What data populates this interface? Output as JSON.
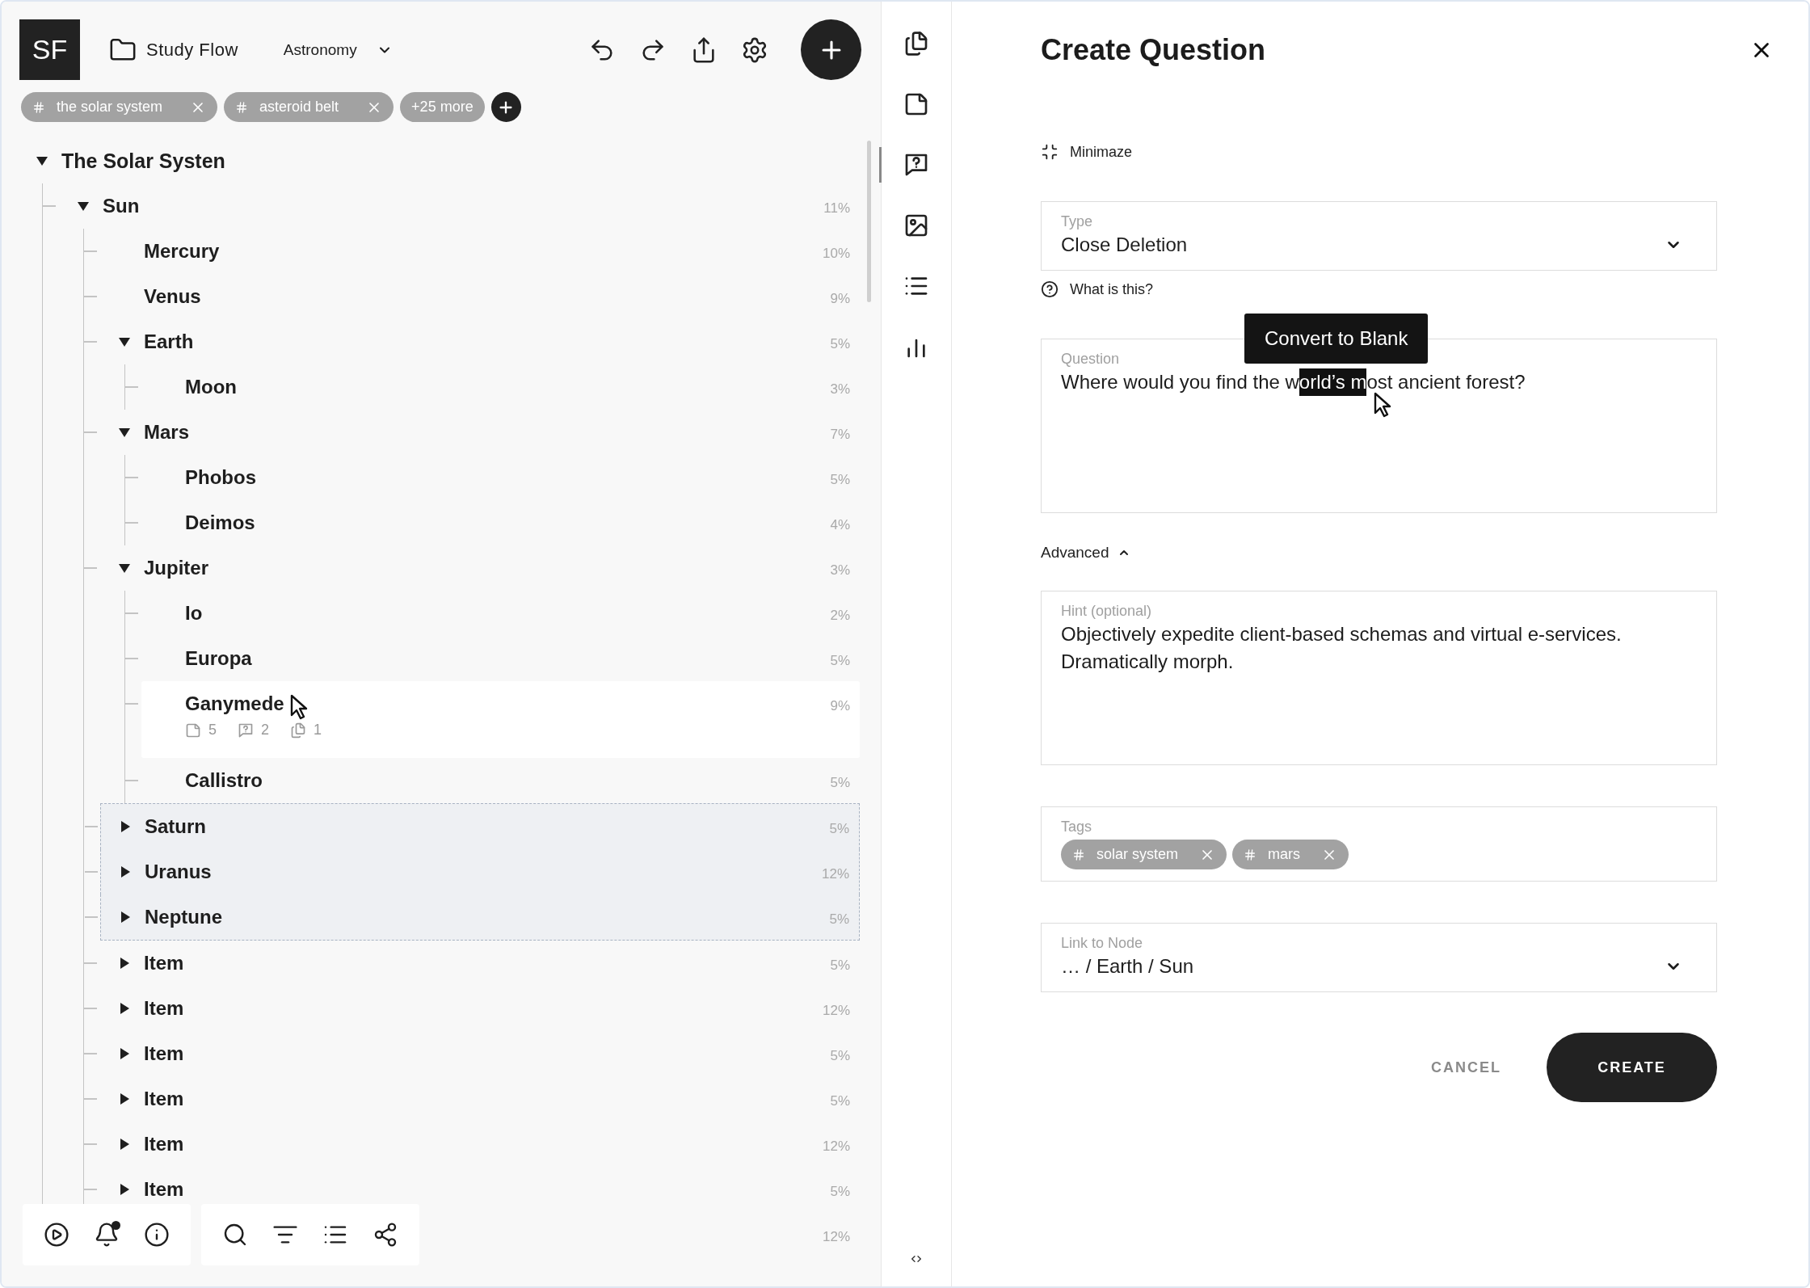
{
  "header": {
    "logo": "SF",
    "project": "Study Flow",
    "subject": "Astronomy"
  },
  "filter_tags": [
    {
      "label": "the solar system",
      "kind": "tag"
    },
    {
      "label": "asteroid belt",
      "kind": "tag"
    },
    {
      "label": "+25 more",
      "kind": "more"
    }
  ],
  "tree": [
    {
      "label": "The Solar Systen",
      "expanded": true,
      "selected": false,
      "hovered": false,
      "children": [
        {
          "label": "Sun",
          "percent": "11%",
          "expanded": true,
          "selected": false,
          "hovered": false,
          "children": [
            {
              "label": "Mercury",
              "percent": "10%",
              "selected": false,
              "hovered": false
            },
            {
              "label": "Venus",
              "percent": "9%",
              "selected": false,
              "hovered": false
            },
            {
              "label": "Earth",
              "percent": "5%",
              "expanded": true,
              "selected": false,
              "hovered": false,
              "children": [
                {
                  "label": "Moon",
                  "percent": "3%",
                  "selected": false,
                  "hovered": false
                }
              ]
            },
            {
              "label": "Mars",
              "percent": "7%",
              "expanded": true,
              "selected": false,
              "hovered": false,
              "children": [
                {
                  "label": "Phobos",
                  "percent": "5%",
                  "selected": false,
                  "hovered": false
                },
                {
                  "label": "Deimos",
                  "percent": "4%",
                  "selected": false,
                  "hovered": false
                }
              ]
            },
            {
              "label": "Jupiter",
              "percent": "3%",
              "expanded": true,
              "selected": false,
              "hovered": false,
              "children": [
                {
                  "label": "Io",
                  "percent": "2%",
                  "selected": false,
                  "hovered": false
                },
                {
                  "label": "Europa",
                  "percent": "5%",
                  "selected": false,
                  "hovered": false
                },
                {
                  "label": "Ganymede",
                  "percent": "9%",
                  "selected": false,
                  "hovered": true,
                  "stats": [
                    {
                      "kind": "notes",
                      "count": "5"
                    },
                    {
                      "kind": "questions",
                      "count": "2"
                    },
                    {
                      "kind": "cards",
                      "count": "1"
                    }
                  ]
                },
                {
                  "label": "Callistro",
                  "percent": "5%",
                  "selected": false,
                  "hovered": false
                }
              ]
            },
            {
              "label": "Saturn",
              "percent": "5%",
              "expanded": false,
              "selected": true,
              "hovered": false
            },
            {
              "label": "Uranus",
              "percent": "12%",
              "expanded": false,
              "selected": true,
              "hovered": false
            },
            {
              "label": "Neptune",
              "percent": "5%",
              "expanded": false,
              "selected": true,
              "hovered": false
            },
            {
              "label": "Item",
              "percent": "5%",
              "expanded": false,
              "selected": false,
              "hovered": false
            },
            {
              "label": "Item",
              "percent": "12%",
              "expanded": false,
              "selected": false,
              "hovered": false
            },
            {
              "label": "Item",
              "percent": "5%",
              "expanded": false,
              "selected": false,
              "hovered": false
            },
            {
              "label": "Item",
              "percent": "5%",
              "expanded": false,
              "selected": false,
              "hovered": false
            },
            {
              "label": "Item",
              "percent": "12%",
              "expanded": false,
              "selected": false,
              "hovered": false
            },
            {
              "label": "Item",
              "percent": "5%",
              "expanded": false,
              "selected": false,
              "hovered": false
            },
            {
              "percent": "12%"
            }
          ]
        }
      ]
    }
  ],
  "bottom_bar": {
    "notifications_unread": true
  },
  "rail": [
    {
      "kind": "cards",
      "selected": false
    },
    {
      "kind": "notes",
      "selected": false
    },
    {
      "kind": "questions",
      "selected": true
    },
    {
      "kind": "image",
      "selected": false
    },
    {
      "kind": "list",
      "selected": false
    },
    {
      "kind": "stats",
      "selected": false
    }
  ],
  "form": {
    "title": "Create Question",
    "minimize": "Minimaze",
    "type_field": {
      "label": "Type",
      "value": "Close Deletion"
    },
    "help_link": "What is this?",
    "tooltip": "Convert to Blank",
    "question_field": {
      "label": "Question",
      "before": "Where would you find the w",
      "highlight": "orld’s m",
      "after": "ost ancient forest?"
    },
    "advanced": {
      "label": "Advanced",
      "expanded": true
    },
    "hint_field": {
      "label": "Hint (optional)",
      "value": "Objectively expedite client-based schemas and virtual e-services. Dramatically morph."
    },
    "tags_field": {
      "label": "Tags",
      "tags": [
        "solar system",
        "mars"
      ]
    },
    "link_field": {
      "label": "Link to Node",
      "value": "… / Earth / Sun"
    },
    "buttons": [
      {
        "label": "CANCEL",
        "kind": "text"
      },
      {
        "label": "CREATE",
        "kind": "primary"
      }
    ]
  }
}
